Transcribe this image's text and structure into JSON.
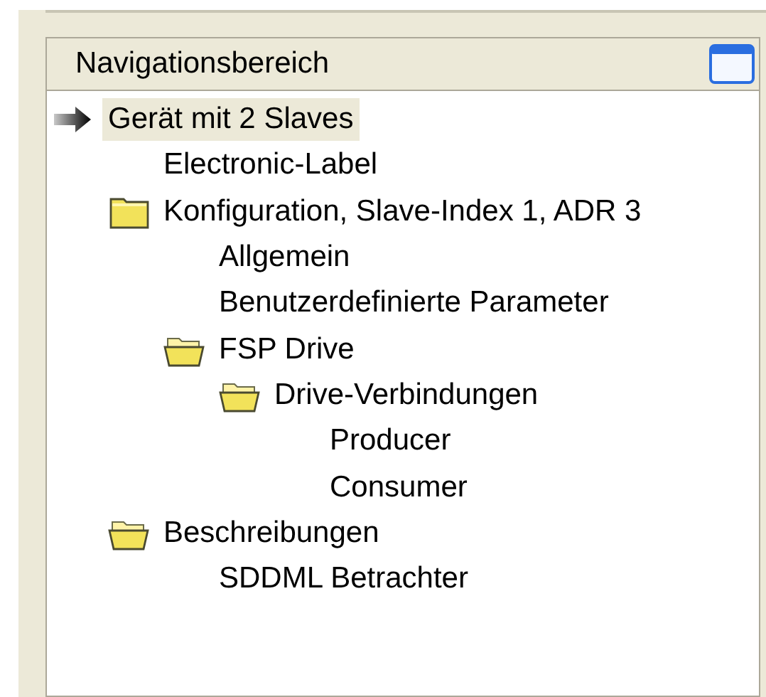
{
  "panel": {
    "title": "Navigationsbereich"
  },
  "tree": [
    {
      "label": "Gerät mit 2 Slaves",
      "kind": "device",
      "selected": true,
      "children": [
        {
          "label": "Electronic-Label",
          "kind": "page",
          "selected": false
        },
        {
          "label": "Konfiguration, Slave-Index 1, ADR 3",
          "kind": "folder",
          "open": false,
          "selected": false,
          "children": [
            {
              "label": "Allgemein",
              "kind": "page",
              "selected": false
            },
            {
              "label": "Benutzerdefinierte Parameter",
              "kind": "page",
              "selected": false
            },
            {
              "label": "FSP Drive",
              "kind": "folder",
              "open": true,
              "selected": false,
              "children": [
                {
                  "label": "Drive-Verbindungen",
                  "kind": "folder",
                  "open": true,
                  "selected": false,
                  "children": [
                    {
                      "label": "Producer",
                      "kind": "page",
                      "selected": false
                    },
                    {
                      "label": "Consumer",
                      "kind": "page",
                      "selected": false
                    }
                  ]
                }
              ]
            }
          ]
        },
        {
          "label": "Beschreibungen",
          "kind": "folder",
          "open": true,
          "selected": false,
          "children": [
            {
              "label": "SDDML Betrachter",
              "kind": "page",
              "selected": false
            }
          ]
        }
      ]
    }
  ]
}
